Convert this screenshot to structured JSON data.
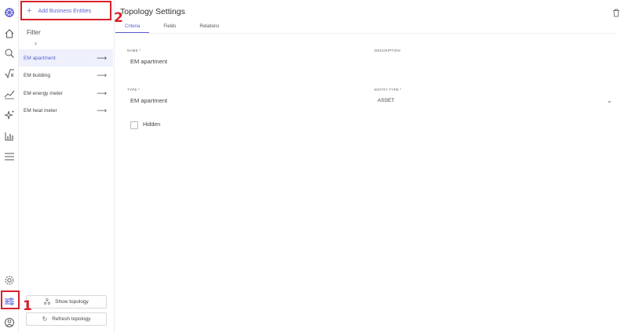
{
  "sidebar_rail": {
    "icons": [
      "logo-icon",
      "home-icon",
      "search-icon",
      "formula-icon",
      "trend-icon",
      "sparkle-icon",
      "chart-icon",
      "menu-icon",
      "settings-icon",
      "topology-settings-icon",
      "user-icon"
    ]
  },
  "panel": {
    "add_button_label": "Add Business Entities",
    "filter_label": "Filter",
    "items": [
      {
        "label": "EM apartment",
        "active": true
      },
      {
        "label": "EM building",
        "active": false
      },
      {
        "label": "EM energy meter",
        "active": false
      },
      {
        "label": "EM heat meter",
        "active": false
      }
    ],
    "show_topology_label": "Show topology",
    "refresh_topology_label": "Refresh topology"
  },
  "annotations": {
    "marker_1": "1",
    "marker_2": "2",
    "color": "#d8202a"
  },
  "main": {
    "title": "Topology Settings",
    "tabs": [
      {
        "label": "Criteria",
        "active": true
      },
      {
        "label": "Fields",
        "active": false
      },
      {
        "label": "Relations",
        "active": false
      }
    ],
    "name_label": "NAME *",
    "name_value": "EM apartment",
    "description_label": "DESCRIPTION",
    "type_label": "TYPE *",
    "type_value": "EM apartment",
    "entity_type_label": "ENTITY TYPE *",
    "entity_type_value": "ASSET",
    "hidden_label": "Hidden"
  },
  "colors": {
    "accent": "#5a5fd6",
    "active_bg": "#eef0fb"
  }
}
